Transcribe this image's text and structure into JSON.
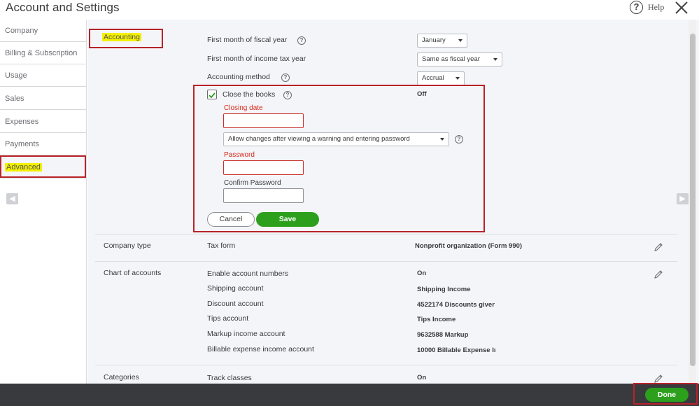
{
  "window": {
    "title": "Account and Settings",
    "help_label": "Help"
  },
  "sidebar": {
    "items": [
      {
        "label": "Company"
      },
      {
        "label": "Billing & Subscription"
      },
      {
        "label": "Usage"
      },
      {
        "label": "Sales"
      },
      {
        "label": "Expenses"
      },
      {
        "label": "Payments"
      },
      {
        "label": "Advanced"
      }
    ],
    "active": "Advanced"
  },
  "accounting": {
    "section_label": "Accounting",
    "fiscal_month_label": "First month of fiscal year",
    "fiscal_month_value": "January",
    "tax_month_label": "First month of income tax year",
    "tax_month_value": "Same as fiscal year",
    "method_label": "Accounting method",
    "method_value": "Accrual",
    "close_books_label": "Close the books",
    "close_books_status": "Off",
    "close_books_checked": true,
    "closing_date_label": "Closing date",
    "closing_date_value": "",
    "allow_changes_value": "Allow changes after viewing a warning and entering password",
    "password_label": "Password",
    "password_value": "",
    "confirm_password_label": "Confirm Password",
    "confirm_password_value": "",
    "cancel_label": "Cancel",
    "save_label": "Save"
  },
  "company_type": {
    "section_label": "Company type",
    "tax_form_label": "Tax form",
    "tax_form_value": "Nonprofit organization (Form 990)"
  },
  "chart_of_accounts": {
    "section_label": "Chart of accounts",
    "rows": [
      {
        "label": "Enable account numbers",
        "value": "On"
      },
      {
        "label": "Shipping account",
        "value": "Shipping Income"
      },
      {
        "label": "Discount account",
        "value": "4522174 Discounts giver"
      },
      {
        "label": "Tips account",
        "value": "Tips Income"
      },
      {
        "label": "Markup income account",
        "value": "9632588 Markup"
      },
      {
        "label": "Billable expense income account",
        "value": "10000 Billable Expense Iı"
      }
    ]
  },
  "categories": {
    "section_label": "Categories",
    "track_classes_label": "Track classes",
    "track_classes_value": "On"
  },
  "footer": {
    "done_label": "Done"
  },
  "colors": {
    "accent_green": "#2ca01c",
    "annotation_red": "#b8232a",
    "highlight_yellow": "#f3f000",
    "footer_bg": "#393a3d",
    "error_red": "#d52b1e"
  },
  "icons": [
    "help-icon",
    "close-icon",
    "question-icon",
    "checkmark-icon",
    "pencil-icon",
    "chevron-left-icon",
    "chevron-right-icon",
    "caret-down-icon"
  ]
}
